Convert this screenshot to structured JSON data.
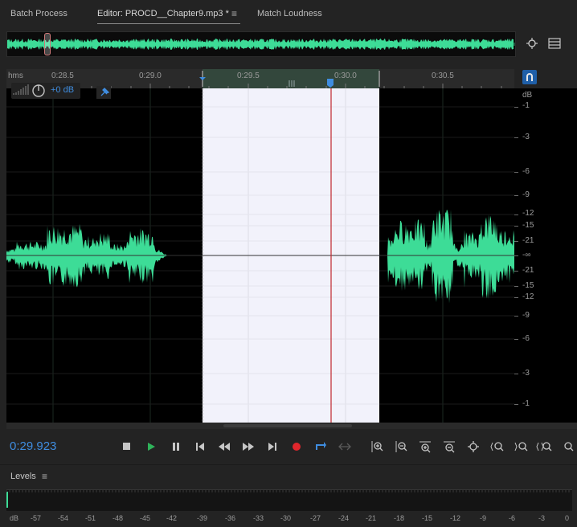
{
  "tabs": {
    "batch": "Batch Process",
    "editor": "Editor: PROCD__Chapter9.mp3 *",
    "editor_menu": "≡",
    "loudness": "Match Loudness"
  },
  "ruler": {
    "unit": "hms",
    "ticks": [
      "0:28.5",
      "0:29.0",
      "0:29.5",
      "0:30.0",
      "0:30.5"
    ]
  },
  "clip_controls": {
    "volume": "+0 dB"
  },
  "db_scale": {
    "header": "dB",
    "labels": [
      "-1",
      "-3",
      "-6",
      "-9",
      "-12",
      "-15",
      "-21",
      "-∞",
      "-21",
      "-15",
      "-12",
      "-9",
      "-6",
      "-3",
      "-1"
    ]
  },
  "transport": {
    "time": "0:29.923"
  },
  "levels": {
    "title": "Levels",
    "menu": "≡",
    "scale": [
      "dB",
      "-57",
      "-54",
      "-51",
      "-48",
      "-45",
      "-42",
      "-39",
      "-36",
      "-33",
      "-30",
      "-27",
      "-24",
      "-21",
      "-18",
      "-15",
      "-12",
      "-9",
      "-6",
      "-3",
      "0"
    ]
  },
  "colors": {
    "waveform": "#3ddc97",
    "accent": "#3f8de0",
    "playhead": "#c0282d",
    "selection": "#f2f2fb"
  }
}
